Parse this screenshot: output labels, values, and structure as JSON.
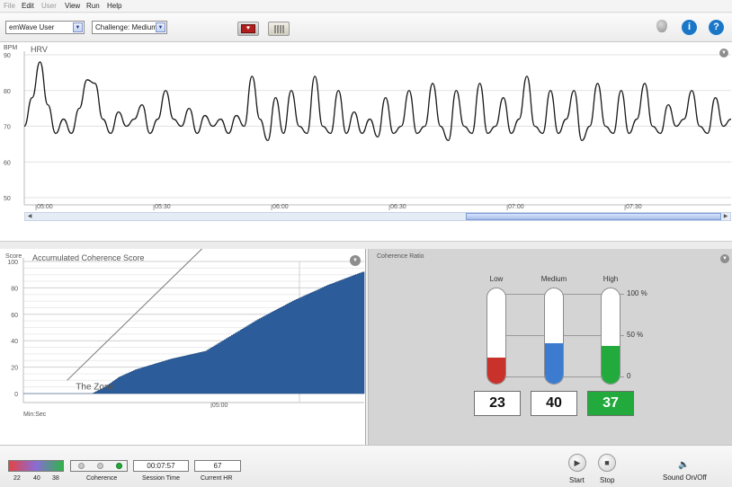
{
  "menu": {
    "items": [
      "File",
      "Edit",
      "User",
      "View",
      "Run",
      "Help"
    ]
  },
  "toolbar": {
    "user_select": "emWave User",
    "challenge_select": "Challenge: Medium"
  },
  "colors": {
    "accent_blue": "#2c5d9a",
    "low_red": "#c8322a",
    "medium_blue": "#3b7bd0",
    "high_green": "#22aa3c",
    "icon_blue": "#1a77c8"
  },
  "hrv": {
    "title": "HRV",
    "y_unit": "BPM",
    "chart_data": {
      "type": "line",
      "title": "HRV",
      "ylabel": "BPM",
      "ylim": [
        50,
        90
      ],
      "y_ticks": [
        "90",
        "80",
        "70",
        "60",
        "50"
      ],
      "x_ticks": [
        "05:00",
        "05:30",
        "06:00",
        "06:30",
        "07:00",
        "07:30"
      ],
      "xlim": [
        0,
        180
      ],
      "x": [
        0,
        2,
        4,
        6,
        8,
        10,
        12,
        14,
        16,
        18,
        20,
        22,
        24,
        26,
        28,
        30,
        32,
        34,
        36,
        38,
        40,
        42,
        44,
        46,
        48,
        50,
        52,
        54,
        56,
        58,
        60,
        62,
        64,
        66,
        68,
        70,
        72,
        74,
        76,
        78,
        80,
        82,
        84,
        86,
        88,
        90,
        92,
        94,
        96,
        98,
        100,
        102,
        104,
        106,
        108,
        110,
        112,
        114,
        116,
        118,
        120,
        122,
        124,
        126,
        128,
        130,
        132,
        134,
        136,
        138,
        140,
        142,
        144,
        146,
        148,
        150,
        152,
        154,
        156,
        158,
        160,
        162,
        164,
        166,
        168,
        170,
        172,
        174,
        176,
        178,
        180
      ],
      "values": [
        70,
        78,
        88,
        76,
        68,
        72,
        68,
        75,
        83,
        82,
        72,
        68,
        74,
        70,
        72,
        76,
        68,
        72,
        80,
        72,
        70,
        75,
        68,
        73,
        70,
        72,
        68,
        73,
        70,
        84,
        72,
        66,
        78,
        68,
        80,
        70,
        68,
        84,
        70,
        68,
        80,
        68,
        74,
        68,
        72,
        67,
        78,
        68,
        70,
        80,
        68,
        70,
        82,
        70,
        66,
        80,
        70,
        68,
        82,
        68,
        70,
        78,
        68,
        72,
        84,
        70,
        68,
        80,
        68,
        72,
        80,
        66,
        70,
        82,
        70,
        68,
        80,
        68,
        72,
        82,
        70,
        68,
        76,
        70,
        72,
        80,
        70,
        68,
        78,
        70,
        72
      ]
    }
  },
  "coherence": {
    "title": "Accumulated Coherence Score",
    "y_unit": "Score",
    "x_unit": "Min:Sec",
    "zone_label": "The Zone",
    "chart_data": {
      "type": "area",
      "title": "Accumulated Coherence Score",
      "ylabel": "Score",
      "xlabel": "Min:Sec",
      "ylim": [
        0,
        100
      ],
      "y_ticks": [
        "100",
        "80",
        "60",
        "40",
        "20",
        "0"
      ],
      "x_ticks": [
        "05:00"
      ],
      "xlim": [
        0,
        7.8
      ],
      "zone_line": {
        "x": [
          1.0,
          4.1
        ],
        "y": [
          10,
          110
        ]
      },
      "x": [
        0,
        1.6,
        1.9,
        2.2,
        2.6,
        3.0,
        3.4,
        3.8,
        4.2,
        4.6,
        5.0,
        5.4,
        5.8,
        6.2,
        6.6,
        7.0,
        7.4,
        7.8
      ],
      "values": [
        0,
        0,
        5,
        12,
        18,
        22,
        26,
        29,
        32,
        40,
        48,
        56,
        63,
        70,
        76,
        82,
        87,
        92
      ]
    }
  },
  "ratio": {
    "title": "Coherence Ratio",
    "bars": [
      {
        "label": "Low",
        "value": "23",
        "percent": 23
      },
      {
        "label": "Medium",
        "value": "40",
        "percent": 40
      },
      {
        "label": "High",
        "value": "37",
        "percent": 37
      }
    ],
    "pct_labels": [
      "100 %",
      "50 %",
      "0"
    ]
  },
  "status": {
    "ratio_values": [
      "22",
      "40",
      "38"
    ],
    "coherence_label": "Coherence",
    "session_time": "00:07:57",
    "session_time_label": "Session Time",
    "current_hr": "67",
    "current_hr_label": "Current HR",
    "start_label": "Start",
    "stop_label": "Stop",
    "sound_label": "Sound On/Off"
  }
}
